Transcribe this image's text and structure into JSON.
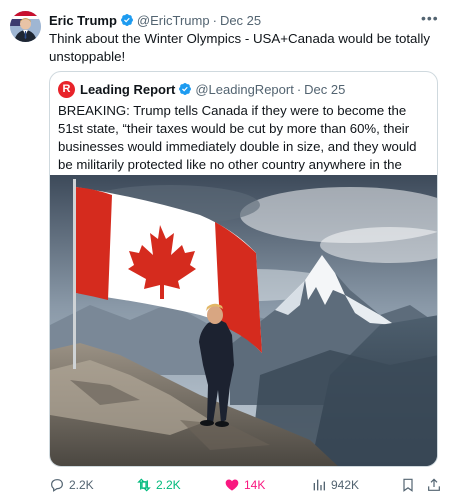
{
  "tweet": {
    "author_name": "Eric Trump",
    "handle": "@EricTrump",
    "separator": "·",
    "date": "Dec 25",
    "text": "Think about the Winter Olympics - USA+Canada would be totally unstoppable!",
    "more_icon": "more-icon"
  },
  "quote": {
    "logo_letter": "R",
    "author_name": "Leading Report",
    "handle": "@LeadingReport",
    "separator": "·",
    "date": "Dec 25",
    "text": "BREAKING: Trump tells Canada if they were to become the 51st state, “their taxes would be cut by more than 60%, their businesses would immediately double in size, and they would be militarily protected like no other country anywhere in the world.”"
  },
  "actions": {
    "replies": "2.2K",
    "reposts": "2.2K",
    "likes": "14K",
    "views": "942K"
  },
  "colors": {
    "verified": "#1d9bf0",
    "repost_active": "#00ba7c",
    "like_active": "#f91880",
    "secondary_text": "#536471",
    "flag_red": "#d52b1e",
    "logo_red": "#e8232a"
  }
}
